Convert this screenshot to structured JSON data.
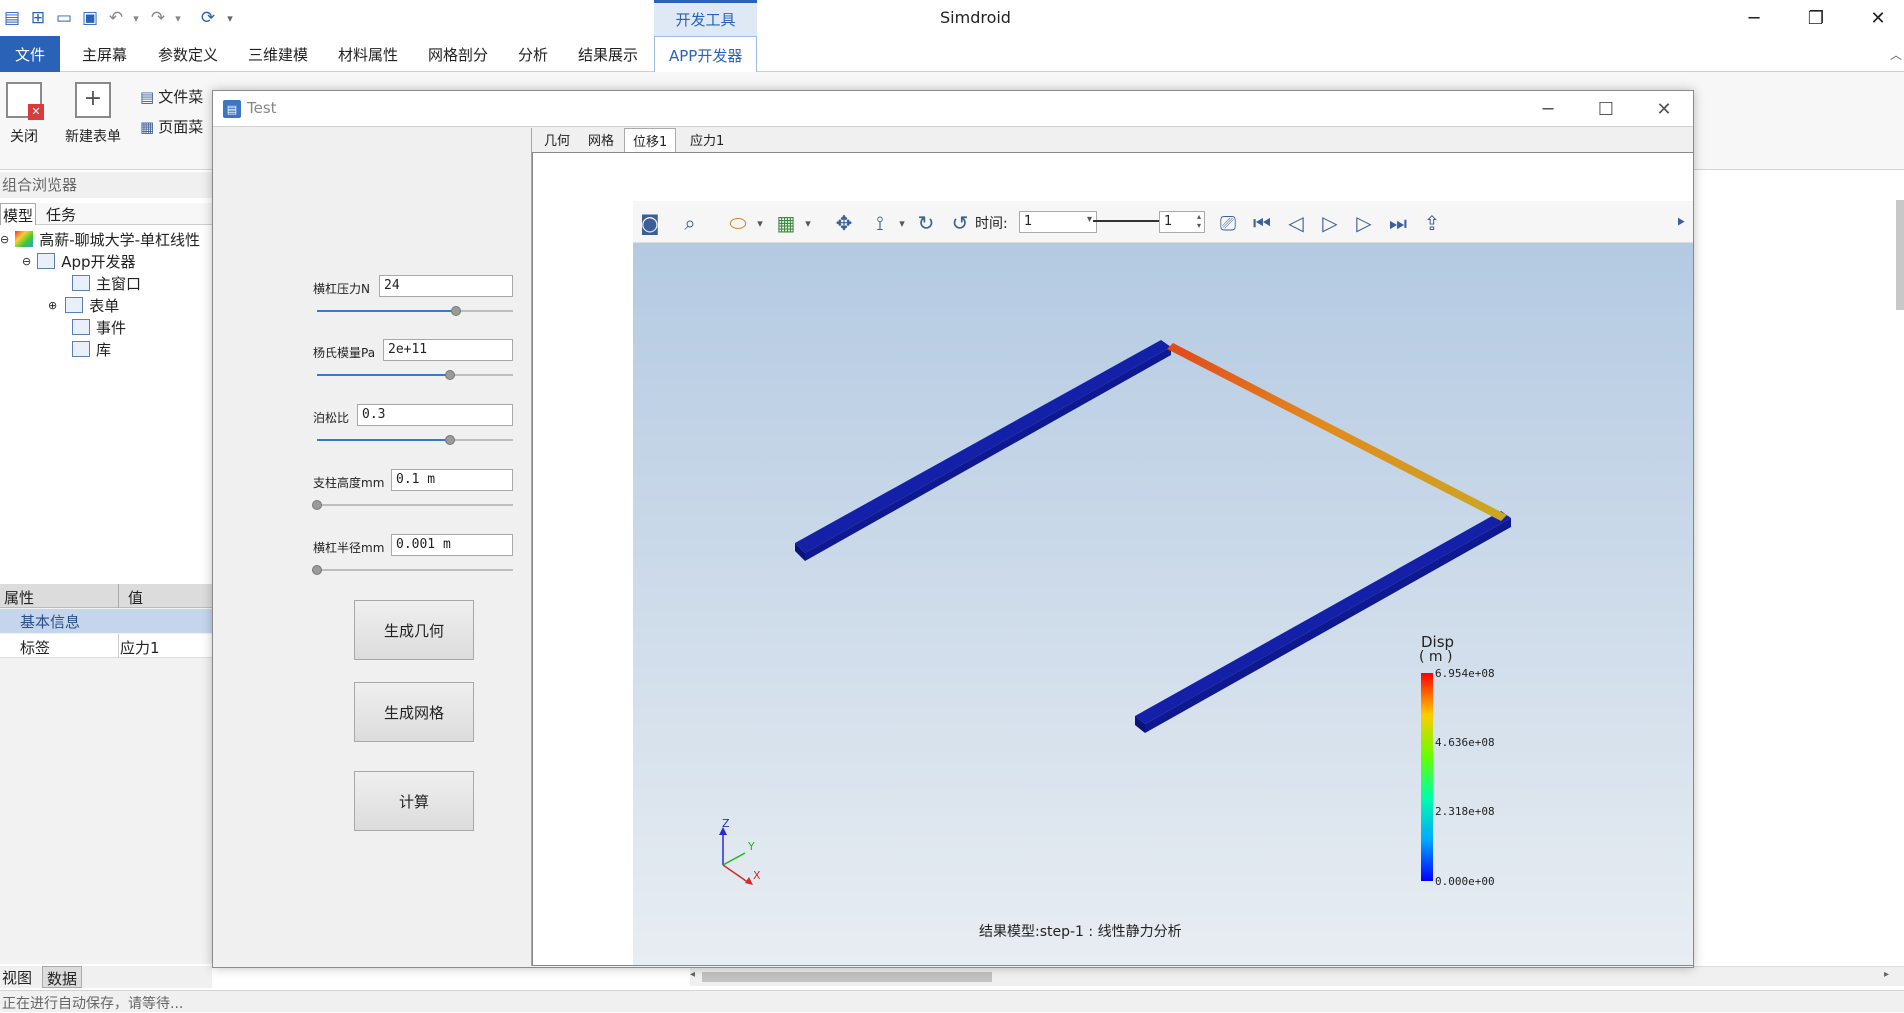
{
  "titlebar": {
    "app_title": "Simdroid",
    "context_tab": "开发工具"
  },
  "menu": {
    "file": "文件",
    "items": [
      "主屏幕",
      "参数定义",
      "三维建模",
      "材料属性",
      "网格剖分",
      "分析",
      "结果展示"
    ],
    "active": "APP开发器"
  },
  "ribbon": {
    "close_label": "关闭",
    "new_form_label": "新建表单",
    "file_menu_label": "文件菜",
    "page_menu_label": "页面菜"
  },
  "browser": {
    "title": "组合浏览器",
    "tabs": [
      "模型",
      "任务"
    ],
    "tree": [
      "高薪-聊城大学-单杠线性",
      "App开发器",
      "主窗口",
      "表单",
      "事件",
      "库"
    ]
  },
  "properties": {
    "col_property": "属性",
    "col_value": "值",
    "group": "基本信息",
    "row_key": "标签",
    "row_value": "应力1"
  },
  "bottom_tabs": [
    "视图",
    "数据"
  ],
  "status": "正在进行自动保存，请等待...",
  "dialog": {
    "title": "Test",
    "fields": [
      {
        "label": "横杠压力N",
        "value": "24",
        "slider": 0.71
      },
      {
        "label": "杨氏模量Pa",
        "value": "2e+11",
        "slider": 0.68
      },
      {
        "label": "泊松比",
        "value": "0.3",
        "slider": 0.68
      },
      {
        "label": "支柱高度mm",
        "value": "0.1 m",
        "slider": 0.0
      },
      {
        "label": "横杠半径mm",
        "value": "0.001 m",
        "slider": 0.0
      }
    ],
    "buttons": [
      "生成几何",
      "生成网格",
      "计算"
    ]
  },
  "viewer": {
    "tabs": [
      "几何",
      "网格",
      "位移1",
      "应力1"
    ],
    "active_tab": "位移1",
    "time_label": "时间:",
    "time_value": "1",
    "step_value": "1",
    "caption": "结果模型:step-1 : 线性静力分析",
    "legend": {
      "title": "Disp",
      "unit": "( m )",
      "values": [
        "6.954e+08",
        "4.636e+08",
        "2.318e+08",
        "0.000e+00"
      ]
    },
    "axes": {
      "z": "Z",
      "y": "Y",
      "x": "X"
    }
  }
}
